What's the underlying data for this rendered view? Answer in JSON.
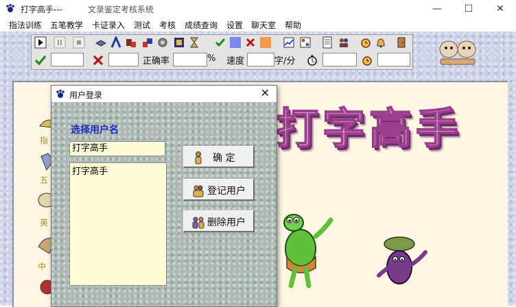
{
  "window": {
    "app_title": "打字高手---",
    "sub_title": "文录鉴定考核系统",
    "controls": [
      "—",
      "☐",
      "✕"
    ]
  },
  "menu": [
    "指法训练",
    "五笔教学",
    "卡证录入",
    "测试",
    "考核",
    "成绩查询",
    "设置",
    "聊天室",
    "帮助"
  ],
  "status_bar": {
    "accuracy_label": "正确率",
    "percent_unit": "%",
    "speed_label": "速度",
    "speed_unit": "字/分"
  },
  "banner_text": "打字高手",
  "side_labels": [
    "指",
    "五",
    "英",
    "中"
  ],
  "login_dialog": {
    "title": "用户登录",
    "close": "✕",
    "select_label": "选择用户名",
    "username_value": "打字高手",
    "users": [
      "打字高手"
    ],
    "buttons": {
      "ok": "确   定",
      "register": "登记用户",
      "delete": "删除用户"
    }
  },
  "colors": {
    "workspace_bg": "#cdd2e8",
    "dialog_bg": "#aeb9b6",
    "field_bg": "#fffbd6",
    "label_blue": "#1c2bb8",
    "banner_purple": "#9d3d8d"
  }
}
